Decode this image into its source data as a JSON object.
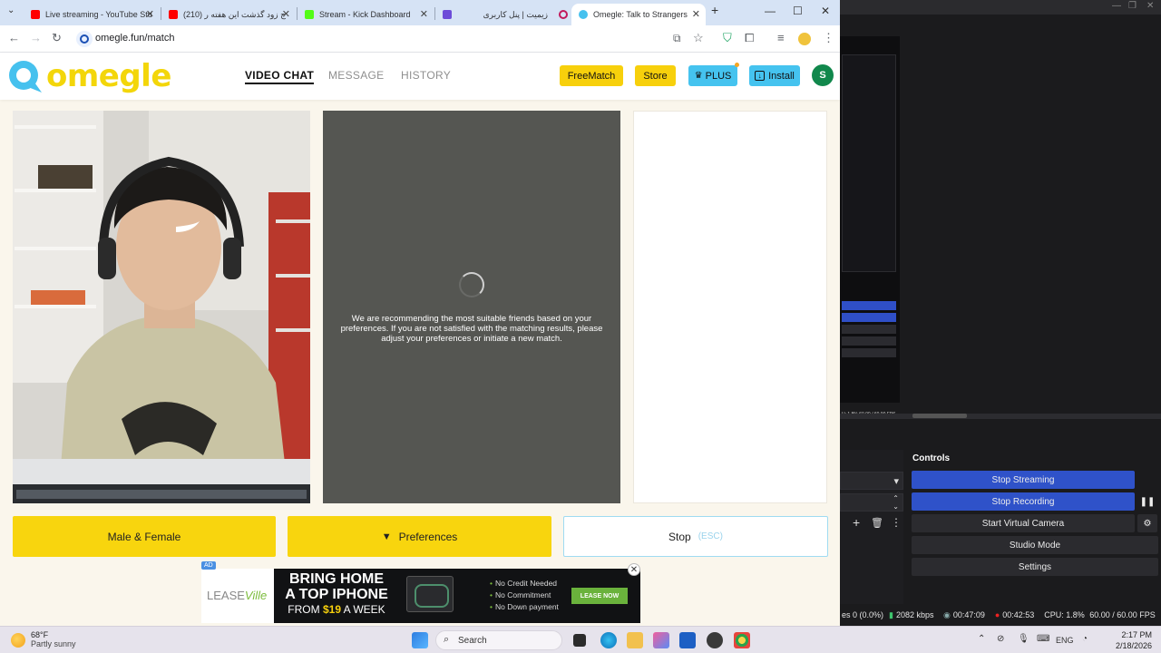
{
  "browser": {
    "tabs": [
      {
        "title": "Live streaming - YouTube Stu",
        "favicon_color": "#ff0000"
      },
      {
        "title": "(210) ج زود گذشت این هفته ر",
        "favicon_color": "#ff0000"
      },
      {
        "title": "Stream - Kick Dashboard",
        "favicon_color": "#53fc18"
      },
      {
        "title": "زیمیت | پنل کاربری",
        "favicon_color": "#6c4bd8"
      },
      {
        "title": "Omegle: Talk to Strangers",
        "favicon_color": "#46c1ee",
        "active": true
      }
    ],
    "new_tab": "+",
    "window_controls": {
      "minimize": "—",
      "maximize": "☐",
      "close": "✕"
    },
    "url": "omegle.fun/match"
  },
  "site": {
    "logo_text": "omegle",
    "nav": [
      {
        "label": "VIDEO CHAT",
        "active": true
      },
      {
        "label": "MESSAGE",
        "active": false
      },
      {
        "label": "HISTORY",
        "active": false
      }
    ],
    "buttons": {
      "freematch": "FreeMatch",
      "store": "Store",
      "plus": "PLUS",
      "install": "Install"
    },
    "avatar_initial": "S",
    "match_message": "We are recommending the most suitable friends based on your preferences. If you are not satisfied with the matching results, please adjust your preferences or initiate a new match.",
    "actions": {
      "gender": "Male & Female",
      "preferences": "Preferences",
      "stop": "Stop",
      "stop_hint": "(ESC)"
    }
  },
  "ad": {
    "tag": "AD",
    "brand_a": "LEASE",
    "brand_b": "Ville",
    "headline": "BRING HOME A TOP IPHONE",
    "price_prefix": "FROM ",
    "price": "$19",
    "price_suffix": " A WEEK",
    "bullets": [
      "No Credit Needed",
      "No Commitment",
      "No Down payment"
    ],
    "cta": "LEASE NOW",
    "close": "✕"
  },
  "obs": {
    "controls_title": "Controls",
    "buttons": [
      {
        "label": "Stop Streaming",
        "active": true
      },
      {
        "label": "Stop Recording",
        "active": true
      },
      {
        "label": "Start Virtual Camera",
        "active": false
      },
      {
        "label": "Studio Mode",
        "active": false
      },
      {
        "label": "Settings",
        "active": false
      }
    ],
    "status": {
      "dropped": "es 0 (0.0%)",
      "bitrate": "2082 kbps",
      "stream_time": "00:47:09",
      "rec_time": "00:42:53",
      "cpu": "CPU: 1.8%",
      "fps": "60.00 / 60.00 FPS"
    },
    "mini_status": "U: 1.8%   60.00 / 60.00 FPS",
    "mini_clock": "2:17 PM\n2/18/2026"
  },
  "taskbar": {
    "weather_temp": "68°F",
    "weather_desc": "Partly sunny",
    "search": "Search",
    "lang": "ENG",
    "time": "2:17 PM",
    "date": "2/18/2026"
  }
}
